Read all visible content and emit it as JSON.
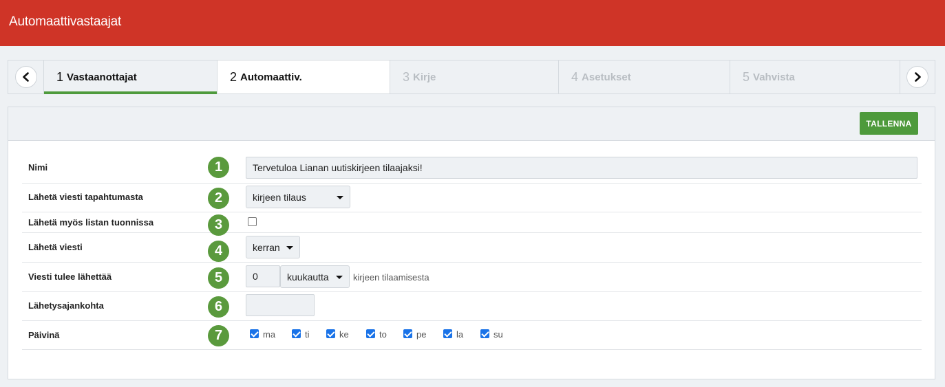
{
  "app": {
    "title": "Automaattivastaajat"
  },
  "wizard": {
    "steps": [
      {
        "num": "1",
        "label": "Vastaanottajat"
      },
      {
        "num": "2",
        "label": "Automaattiv."
      },
      {
        "num": "3",
        "label": "Kirje"
      },
      {
        "num": "4",
        "label": "Asetukset"
      },
      {
        "num": "5",
        "label": "Vahvista"
      }
    ]
  },
  "toolbar": {
    "save_label": "TALLENNA"
  },
  "form": {
    "name": {
      "label": "Nimi",
      "badge": "1",
      "value": "Tervetuloa Lianan uutiskirjeen tilaajaksi!"
    },
    "event": {
      "label": "Lähetä viesti tapahtumasta",
      "badge": "2",
      "value": "kirjeen tilaus"
    },
    "import": {
      "label": "Lähetä myös listan tuonnissa",
      "badge": "3",
      "checked": false
    },
    "send": {
      "label": "Lähetä viesti",
      "badge": "4",
      "value": "kerran"
    },
    "delay": {
      "label": "Viesti tulee lähettää",
      "badge": "5",
      "amount": "0",
      "unit": "kuukautta",
      "suffix": "kirjeen tilaamisesta"
    },
    "time": {
      "label": "Lähetysajankohta",
      "badge": "6",
      "value": ""
    },
    "days": {
      "label": "Päivinä",
      "badge": "7",
      "items": [
        {
          "label": "ma",
          "checked": true
        },
        {
          "label": "ti",
          "checked": true
        },
        {
          "label": "ke",
          "checked": true
        },
        {
          "label": "to",
          "checked": true
        },
        {
          "label": "pe",
          "checked": true
        },
        {
          "label": "la",
          "checked": true
        },
        {
          "label": "su",
          "checked": true
        }
      ]
    }
  },
  "colors": {
    "header": "#cf3427",
    "accent": "#4e9a3c",
    "badge": "#5a9a3d"
  }
}
